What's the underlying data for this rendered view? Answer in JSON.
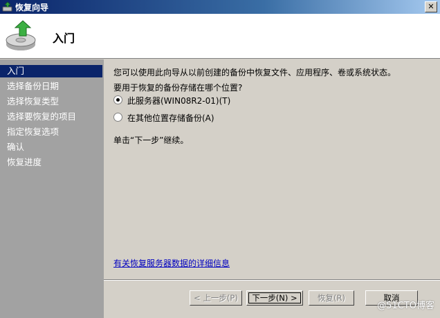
{
  "window": {
    "title": "恢复向导",
    "close_symbol": "✕"
  },
  "header": {
    "title": "入门"
  },
  "sidebar": {
    "items": [
      {
        "label": "入门",
        "active": true
      },
      {
        "label": "选择备份日期"
      },
      {
        "label": "选择恢复类型"
      },
      {
        "label": "选择要恢复的项目"
      },
      {
        "label": "指定恢复选项"
      },
      {
        "label": "确认"
      },
      {
        "label": "恢复进度"
      }
    ]
  },
  "main": {
    "intro": "您可以使用此向导从以前创建的备份中恢复文件、应用程序、卷或系统状态。",
    "question": "要用于恢复的备份存储在哪个位置?",
    "options": [
      {
        "label": "此服务器(WIN08R2-01)(T)",
        "checked": true
      },
      {
        "label": "在其他位置存储备份(A)",
        "checked": false
      }
    ],
    "instruction": "单击“下一步”继续。",
    "link": "有关恢复服务器数据的详细信息"
  },
  "buttons": {
    "prev": "< 上一步(P)",
    "next": "下一步(N) >",
    "recover": "恢复(R)",
    "cancel": "取消"
  },
  "watermark": "@51CTO博客"
}
